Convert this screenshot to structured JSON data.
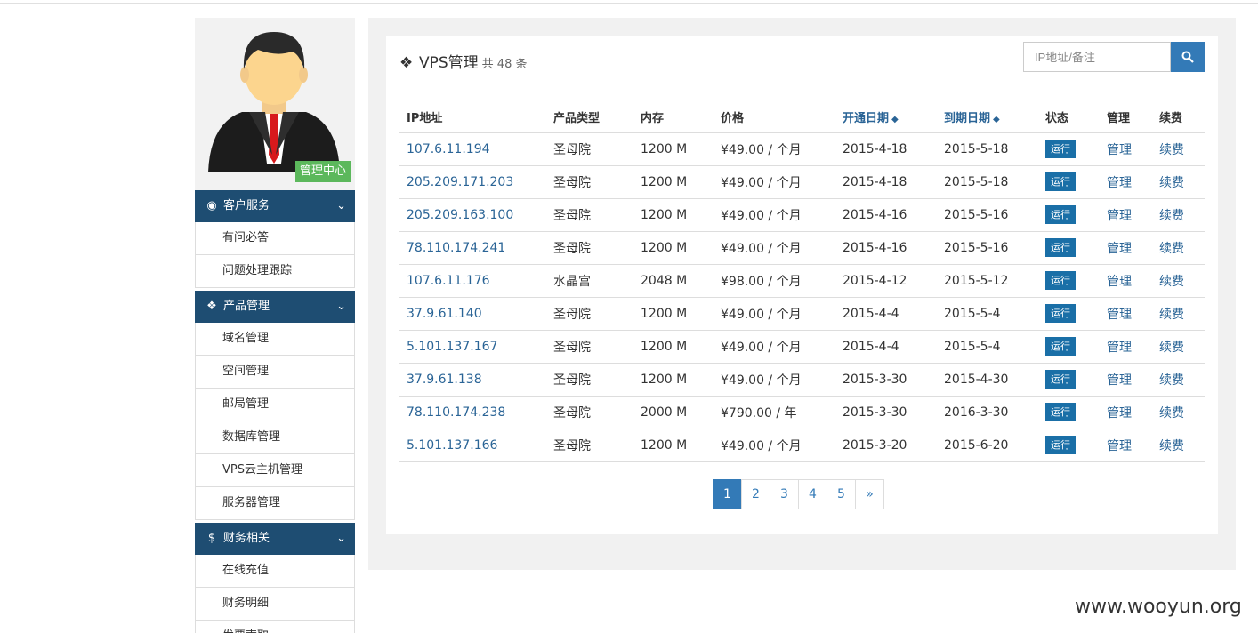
{
  "sidebar": {
    "admin_badge": "管理中心",
    "sections": [
      {
        "title": "客户服务",
        "icon": "dashboard-icon",
        "items": [
          "有问必答",
          "问题处理跟踪"
        ]
      },
      {
        "title": "产品管理",
        "icon": "cubes-icon",
        "items": [
          "域名管理",
          "空间管理",
          "邮局管理",
          "数据库管理",
          "VPS云主机管理",
          "服务器管理"
        ]
      },
      {
        "title": "财务相关",
        "icon": "dollar-icon",
        "items": [
          "在线充值",
          "财务明细",
          "发票索取"
        ]
      }
    ]
  },
  "panel": {
    "title": "VPS管理",
    "count_text": "共 48 条",
    "search_placeholder": "IP地址/备注"
  },
  "table": {
    "headers": [
      "IP地址",
      "产品类型",
      "内存",
      "价格",
      "开通日期",
      "到期日期",
      "状态",
      "管理",
      "续费"
    ],
    "rows": [
      {
        "ip": "107.6.11.194",
        "type": "圣母院",
        "mem": "1200 M",
        "price": "¥49.00 / 个月",
        "start": "2015-4-18",
        "end": "2015-5-18",
        "status": "运行",
        "manage": "管理",
        "renew": "续费"
      },
      {
        "ip": "205.209.171.203",
        "type": "圣母院",
        "mem": "1200 M",
        "price": "¥49.00 / 个月",
        "start": "2015-4-18",
        "end": "2015-5-18",
        "status": "运行",
        "manage": "管理",
        "renew": "续费"
      },
      {
        "ip": "205.209.163.100",
        "type": "圣母院",
        "mem": "1200 M",
        "price": "¥49.00 / 个月",
        "start": "2015-4-16",
        "end": "2015-5-16",
        "status": "运行",
        "manage": "管理",
        "renew": "续费"
      },
      {
        "ip": "78.110.174.241",
        "type": "圣母院",
        "mem": "1200 M",
        "price": "¥49.00 / 个月",
        "start": "2015-4-16",
        "end": "2015-5-16",
        "status": "运行",
        "manage": "管理",
        "renew": "续费"
      },
      {
        "ip": "107.6.11.176",
        "type": "水晶宫",
        "mem": "2048 M",
        "price": "¥98.00 / 个月",
        "start": "2015-4-12",
        "end": "2015-5-12",
        "status": "运行",
        "manage": "管理",
        "renew": "续费"
      },
      {
        "ip": "37.9.61.140",
        "type": "圣母院",
        "mem": "1200 M",
        "price": "¥49.00 / 个月",
        "start": "2015-4-4",
        "end": "2015-5-4",
        "status": "运行",
        "manage": "管理",
        "renew": "续费"
      },
      {
        "ip": "5.101.137.167",
        "type": "圣母院",
        "mem": "1200 M",
        "price": "¥49.00 / 个月",
        "start": "2015-4-4",
        "end": "2015-5-4",
        "status": "运行",
        "manage": "管理",
        "renew": "续费"
      },
      {
        "ip": "37.9.61.138",
        "type": "圣母院",
        "mem": "1200 M",
        "price": "¥49.00 / 个月",
        "start": "2015-3-30",
        "end": "2015-4-30",
        "status": "运行",
        "manage": "管理",
        "renew": "续费"
      },
      {
        "ip": "78.110.174.238",
        "type": "圣母院",
        "mem": "2000 M",
        "price": "¥790.00 / 年",
        "start": "2015-3-30",
        "end": "2016-3-30",
        "status": "运行",
        "manage": "管理",
        "renew": "续费"
      },
      {
        "ip": "5.101.137.166",
        "type": "圣母院",
        "mem": "1200 M",
        "price": "¥49.00 / 个月",
        "start": "2015-3-20",
        "end": "2015-6-20",
        "status": "运行",
        "manage": "管理",
        "renew": "续费"
      }
    ]
  },
  "pagination": {
    "pages": [
      "1",
      "2",
      "3",
      "4",
      "5"
    ],
    "next": "»",
    "active": "1"
  },
  "watermark": "www.wooyun.org",
  "colors": {
    "sidebar_header": "#1e4d72",
    "accent": "#337ab7",
    "badge": "#5cb85c",
    "status": "#1a6fa7"
  }
}
